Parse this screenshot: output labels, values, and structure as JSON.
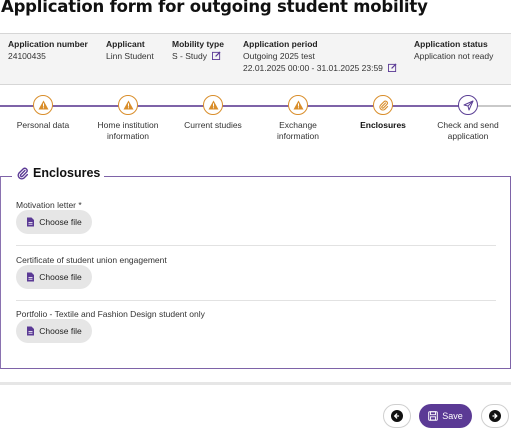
{
  "page_title": "Application form for outgoing student mobility",
  "summary": {
    "application_number": {
      "label": "Application number",
      "value": "24100435"
    },
    "applicant": {
      "label": "Applicant",
      "value": "Linn Student"
    },
    "mobility_type": {
      "label": "Mobility type",
      "value": "S - Study"
    },
    "application_period": {
      "label": "Application period",
      "name": "Outgoing 2025 test",
      "dates": "22.01.2025 00:00 - 31.01.2025 23:59"
    },
    "application_status": {
      "label": "Application status",
      "value": "Application not ready"
    }
  },
  "steps": [
    {
      "line1": "Personal data",
      "line2": "",
      "icon": "warning-icon",
      "state": "warning"
    },
    {
      "line1": "Home institution",
      "line2": "information",
      "icon": "warning-icon",
      "state": "warning"
    },
    {
      "line1": "Current studies",
      "line2": "",
      "icon": "warning-icon",
      "state": "warning"
    },
    {
      "line1": "Exchange",
      "line2": "information",
      "icon": "warning-icon",
      "state": "warning"
    },
    {
      "line1": "Enclosures",
      "line2": "",
      "icon": "paperclip-icon",
      "state": "active"
    },
    {
      "line1": "Check and send",
      "line2": "application",
      "icon": "send-icon",
      "state": "pending"
    }
  ],
  "enclosures": {
    "title": "Enclosures",
    "fields": [
      {
        "label": "Motivation letter *",
        "button": "Choose file"
      },
      {
        "label": "Certificate of student union engagement",
        "button": "Choose file"
      },
      {
        "label": "Portfolio - Textile and Fashion Design student only",
        "button": "Choose file"
      }
    ]
  },
  "footer": {
    "save_label": "Save"
  },
  "colors": {
    "accent": "#5b3a95",
    "warning": "#d98e2b",
    "step_line": "#7e63a8"
  }
}
